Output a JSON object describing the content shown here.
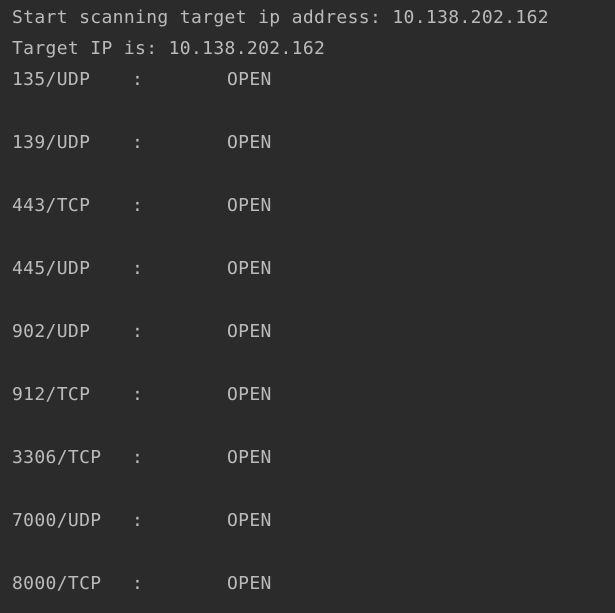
{
  "console": {
    "header_lines": [
      "Start scanning target ip address: 10.138.202.162",
      "Target IP is: 10.138.202.162"
    ],
    "separator": ":",
    "results": [
      {
        "port": "135/UDP",
        "status": "OPEN"
      },
      {
        "port": "139/UDP",
        "status": "OPEN"
      },
      {
        "port": "443/TCP",
        "status": "OPEN"
      },
      {
        "port": "445/UDP",
        "status": "OPEN"
      },
      {
        "port": "902/UDP",
        "status": "OPEN"
      },
      {
        "port": "912/TCP",
        "status": "OPEN"
      },
      {
        "port": "3306/TCP",
        "status": "OPEN"
      },
      {
        "port": "7000/UDP",
        "status": "OPEN"
      },
      {
        "port": "8000/TCP",
        "status": "OPEN"
      }
    ]
  },
  "colors": {
    "background": "#2b2b2b",
    "text": "#bbbbbb"
  }
}
